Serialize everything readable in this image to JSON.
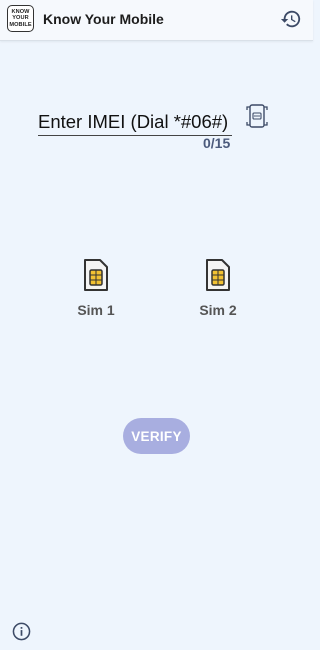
{
  "app_bar": {
    "logo_lines": [
      "KNOW",
      "YOUR",
      "MOBILE"
    ],
    "title": "Know Your Mobile",
    "history_icon": "history-icon"
  },
  "imei_input": {
    "label": "Enter IMEI (Dial *#06#)",
    "counter": "0/15",
    "scan_icon": "scan-icon"
  },
  "sims": [
    {
      "label": "Sim 1",
      "icon": "sim-card-icon"
    },
    {
      "label": "Sim 2",
      "icon": "sim-card-icon"
    }
  ],
  "verify": {
    "label": "VERIFY"
  },
  "footer": {
    "info_icon": "info-icon"
  },
  "colors": {
    "background": "#eef5fd",
    "verify_disabled": "#a8aee0",
    "counter": "#4b5a7c",
    "sim_chip": "#f2c233"
  }
}
